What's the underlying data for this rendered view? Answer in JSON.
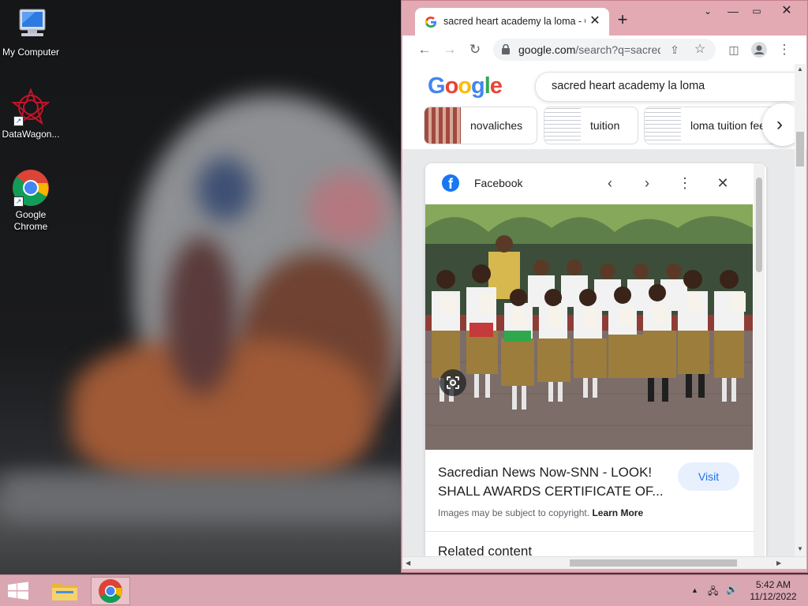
{
  "desktop": {
    "icons": [
      {
        "label": "My Computer",
        "icon": "my-computer-icon"
      },
      {
        "label": "DataWagon...",
        "icon": "datawagon-icon"
      },
      {
        "label": "Google Chrome",
        "icon": "chrome-icon"
      }
    ]
  },
  "browser": {
    "tab_title": "sacred heart academy la loma - Google Search",
    "url_host": "google.com",
    "url_rest": "/search?q=sacred+heart+academy+la+loma",
    "window_controls": [
      "chevron-down-icon",
      "minimize-icon",
      "maximize-icon",
      "close-icon"
    ]
  },
  "google": {
    "logo": [
      "G",
      "o",
      "o",
      "g",
      "l",
      "e"
    ],
    "logo_colors": [
      "#4285f4",
      "#ea4335",
      "#fbbc05",
      "#4285f4",
      "#34a853",
      "#ea4335"
    ],
    "query": "sacred heart academy la loma",
    "chips": [
      {
        "label": "novaliches"
      },
      {
        "label": "tuition"
      },
      {
        "label": "loma tuition fee"
      }
    ]
  },
  "panel": {
    "source": "Facebook",
    "title": "Sacredian News Now-SNN - LOOK! SHALL AWARDS CERTIFICATE OF...",
    "visit_label": "Visit",
    "copyright_text": "Images may be subject to copyright.",
    "learn_more": "Learn More",
    "related_heading": "Related content"
  },
  "taskbar": {
    "time": "5:42 AM",
    "date": "11/12/2022"
  }
}
